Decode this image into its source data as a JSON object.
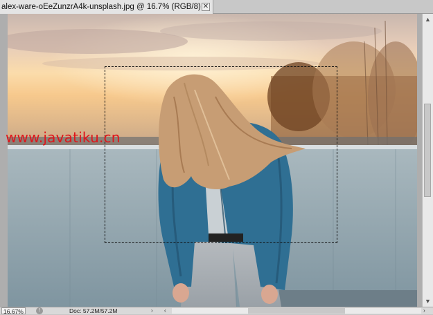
{
  "document": {
    "tab_title": "alex-ware-oEeZunzrA4k-unsplash.jpg @ 16.7% (RGB/8)",
    "close_glyph": "✕"
  },
  "watermark": "www.javatiku.cn",
  "statusbar": {
    "zoom": "16.67%",
    "doc_info": "Doc: 57.2M/57.2M",
    "info_icon": "!",
    "menu_arrow": "›"
  },
  "scrollbars": {
    "up": "▲",
    "down": "▼",
    "left": "‹",
    "right": "›"
  },
  "colors": {
    "sky_top": "#d9c3b4",
    "sunset": "#fbd9a8",
    "wall": "#8da2ad",
    "jacket": "#2f6f93",
    "hair": "#c79d74"
  }
}
